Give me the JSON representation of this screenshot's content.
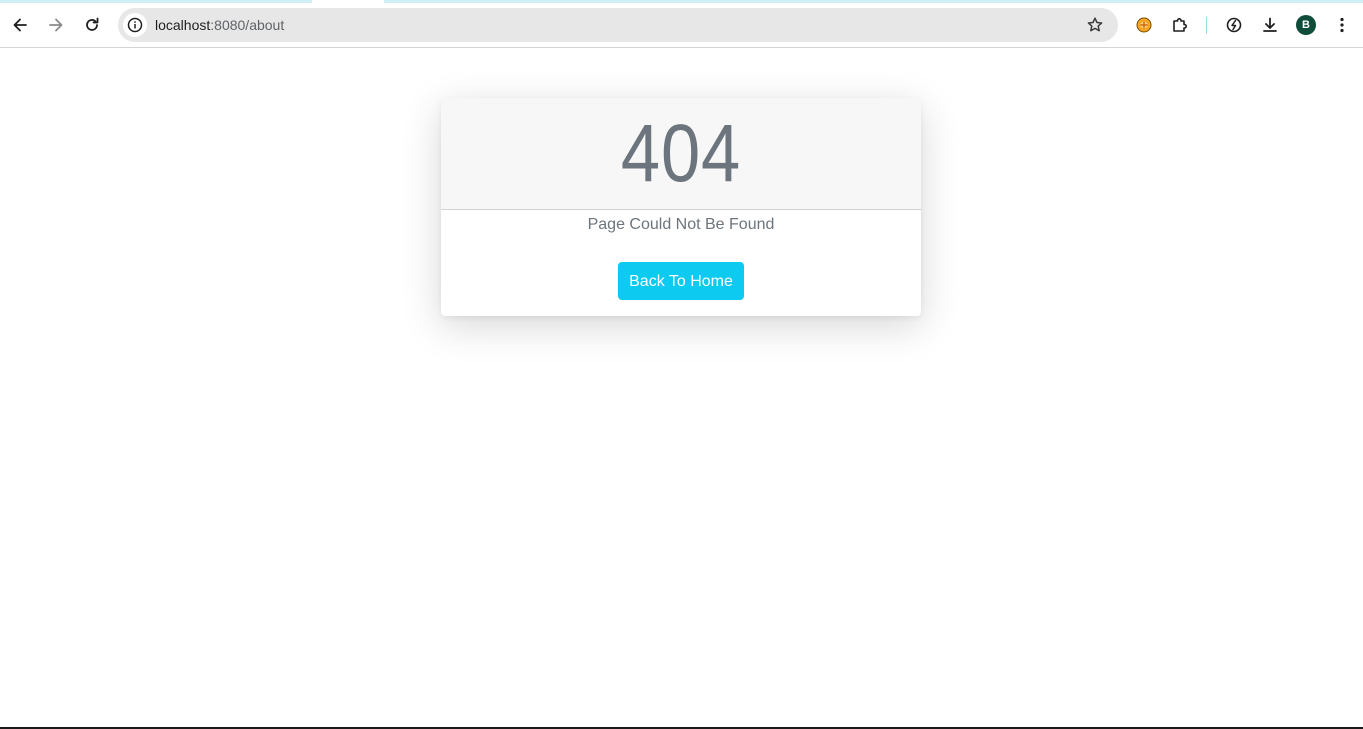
{
  "browser": {
    "url_host": "localhost",
    "url_rest": ":8080/about",
    "profile_initial": "B",
    "icons": {
      "back": "back-arrow-icon",
      "forward": "forward-arrow-icon",
      "reload": "reload-icon",
      "site_info": "info-icon",
      "bookmark": "star-icon",
      "extension_1": "orange-extension-icon",
      "extensions": "puzzle-piece-icon",
      "performance": "speedometer-icon",
      "downloads": "download-icon",
      "menu": "kebab-menu-icon"
    }
  },
  "page": {
    "error_code": "404",
    "message": "Page Could Not Be Found",
    "home_button_label": "Back To Home",
    "colors": {
      "text_muted": "#6c757d",
      "button": "#0dcaf0",
      "header_bg": "#f7f7f7"
    }
  }
}
